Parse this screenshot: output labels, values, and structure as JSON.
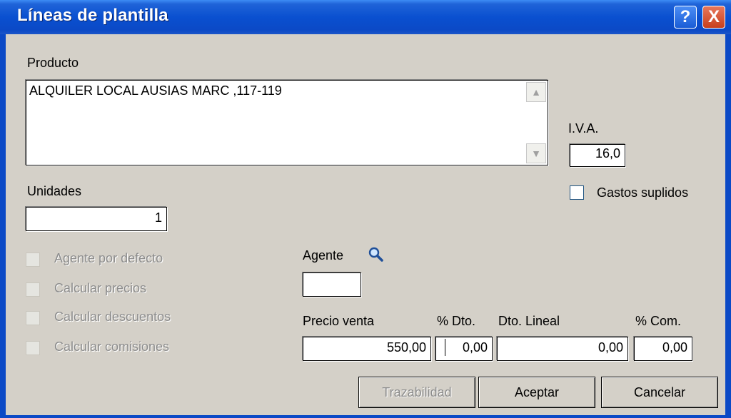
{
  "window": {
    "title": "Líneas de plantilla",
    "help_glyph": "?",
    "close_glyph": "X"
  },
  "producto": {
    "label": "Producto",
    "value": "ALQUILER LOCAL AUSIAS MARC ,117-119"
  },
  "iva": {
    "label": "I.V.A.",
    "value": "16,0"
  },
  "gastos": {
    "label": "Gastos suplidos",
    "checked": false
  },
  "unidades": {
    "label": "Unidades",
    "value": "1"
  },
  "options": [
    {
      "label": "Agente por defecto",
      "enabled": false
    },
    {
      "label": "Calcular precios",
      "enabled": false
    },
    {
      "label": "Calcular descuentos",
      "enabled": false
    },
    {
      "label": "Calcular comisiones",
      "enabled": false
    }
  ],
  "agente": {
    "label": "Agente",
    "value": "",
    "icon": "search-icon"
  },
  "precio_venta": {
    "label": "Precio venta",
    "value": "550,00"
  },
  "dto": {
    "label": "% Dto.",
    "value": "0,00"
  },
  "dto_lineal": {
    "label": "Dto. Lineal",
    "value": "0,00"
  },
  "com": {
    "label": "% Com.",
    "value": "0,00"
  },
  "buttons": {
    "trazabilidad": "Trazabilidad",
    "aceptar": "Aceptar",
    "cancelar": "Cancelar"
  },
  "colors": {
    "titlebar": "#0b49c6",
    "dialog_bg": "#d4d0c8",
    "disabled_text": "#8c8c8c"
  }
}
